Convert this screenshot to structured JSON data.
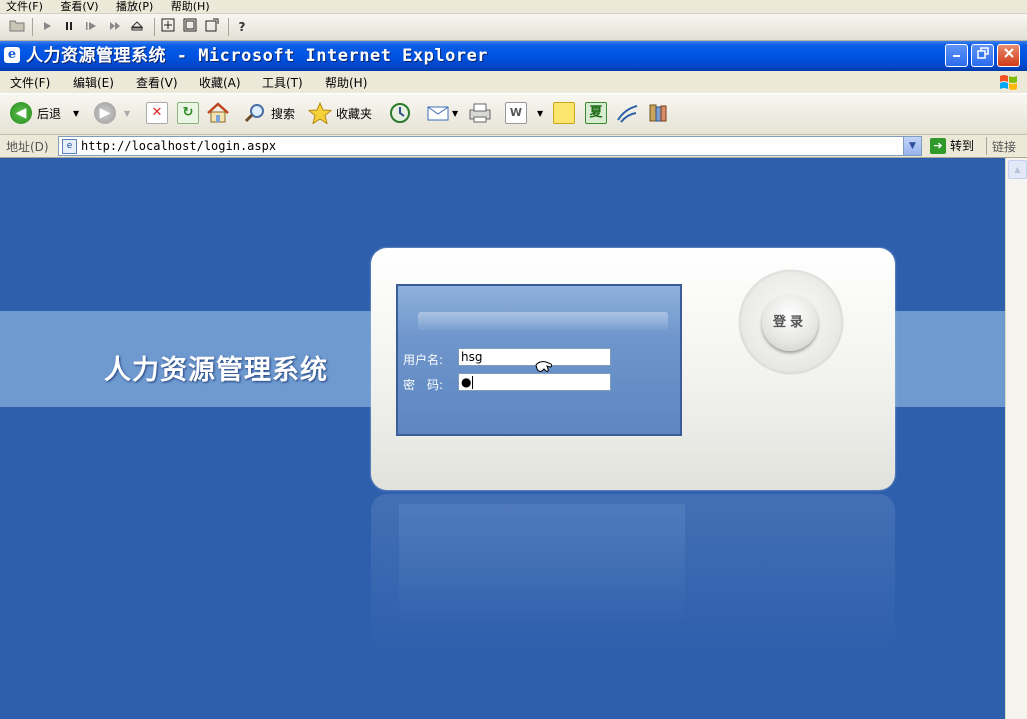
{
  "outer_menu": [
    "文件(F)",
    "查看(V)",
    "播放(P)",
    "帮助(H)"
  ],
  "media_toolbar": {
    "icons": [
      "folder-open-icon",
      "play-icon",
      "pause-icon",
      "step-forward-icon",
      "fast-forward-icon",
      "eject-icon",
      "fullsize-icon",
      "window-icon",
      "resize-icon",
      "help-icon"
    ],
    "help_glyph": "?"
  },
  "window": {
    "title": "人力资源管理系统 - Microsoft Internet Explorer",
    "icon_glyph": "e"
  },
  "ie_menu": [
    "文件(F)",
    "编辑(E)",
    "查看(V)",
    "收藏(A)",
    "工具(T)",
    "帮助(H)"
  ],
  "ie_toolbar": {
    "back_label": "后退",
    "search_label": "搜索",
    "favorites_label": "收藏夹",
    "word_glyph": "W",
    "icons": [
      "back-icon",
      "forward-icon",
      "stop-icon",
      "refresh-icon",
      "home-icon",
      "search-icon",
      "favorites-icon",
      "history-icon",
      "mail-icon",
      "print-icon",
      "word-icon",
      "note-icon",
      "xia-icon",
      "messenger-icon",
      "research-icon"
    ]
  },
  "address_bar": {
    "label": "地址(D)",
    "url": "http://localhost/login.aspx",
    "go_label": "转到",
    "links_label": "链接"
  },
  "page": {
    "system_title": "人力资源管理系统",
    "username_label": "用户名:",
    "password_label": "密　码:",
    "username_value": "hsg",
    "password_mask": "●",
    "login_button": "登录"
  },
  "colors": {
    "page_background": "#2e5fac",
    "band": "#6f9ad0",
    "titlebar": "#0054e3"
  }
}
